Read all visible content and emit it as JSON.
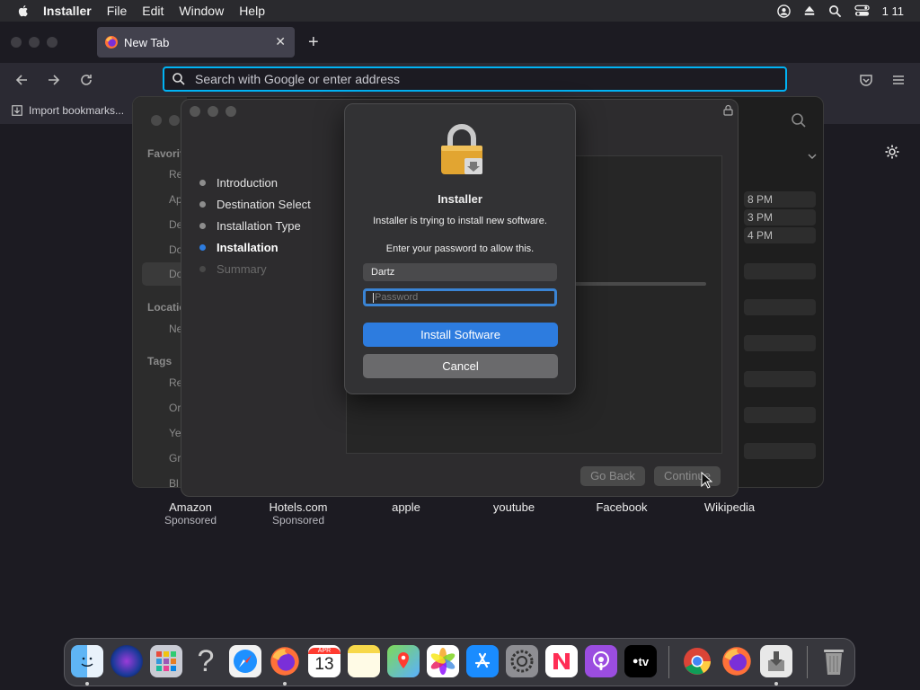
{
  "menubar": {
    "app": "Installer",
    "items": [
      "File",
      "Edit",
      "Window",
      "Help"
    ],
    "clock": "1 11"
  },
  "browser": {
    "tab_title": "New Tab",
    "url_placeholder": "Search with Google or enter address",
    "import_bookmarks": "Import bookmarks..."
  },
  "shortcuts": [
    {
      "name": "Amazon",
      "sub": "Sponsored"
    },
    {
      "name": "Hotels.com",
      "sub": "Sponsored"
    },
    {
      "name": "apple",
      "sub": ""
    },
    {
      "name": "youtube",
      "sub": ""
    },
    {
      "name": "Facebook",
      "sub": ""
    },
    {
      "name": "Wikipedia",
      "sub": ""
    }
  ],
  "finder": {
    "sections": [
      "Favorit",
      "Locatio",
      "Tags"
    ],
    "items": [
      "Re",
      "Ap",
      "De",
      "Do",
      "Do",
      "Ne",
      "Re",
      "Or",
      "Ye",
      "Gr",
      "Bl"
    ],
    "times": [
      "8 PM",
      "3 PM",
      "4 PM"
    ]
  },
  "installer": {
    "steps": [
      {
        "label": "Introduction",
        "state": "done"
      },
      {
        "label": "Destination Select",
        "state": "done"
      },
      {
        "label": "Installation Type",
        "state": "done"
      },
      {
        "label": "Installation",
        "state": "active"
      },
      {
        "label": "Summary",
        "state": "pending"
      }
    ],
    "go_back": "Go Back",
    "continue": "Continue"
  },
  "dialog": {
    "title": "Installer",
    "message": "Installer is trying to install new software.",
    "prompt": "Enter your password to allow this.",
    "username": "Dartz",
    "password_placeholder": "Password",
    "install_button": "Install Software",
    "cancel_button": "Cancel"
  },
  "dock": {
    "calendar_month": "APR",
    "calendar_day": "13",
    "tv_label": "tv"
  },
  "colors": {
    "accent": "#2d7cdf",
    "url_focus": "#00b3f4",
    "active_step_dot": "#2d7cdf"
  }
}
